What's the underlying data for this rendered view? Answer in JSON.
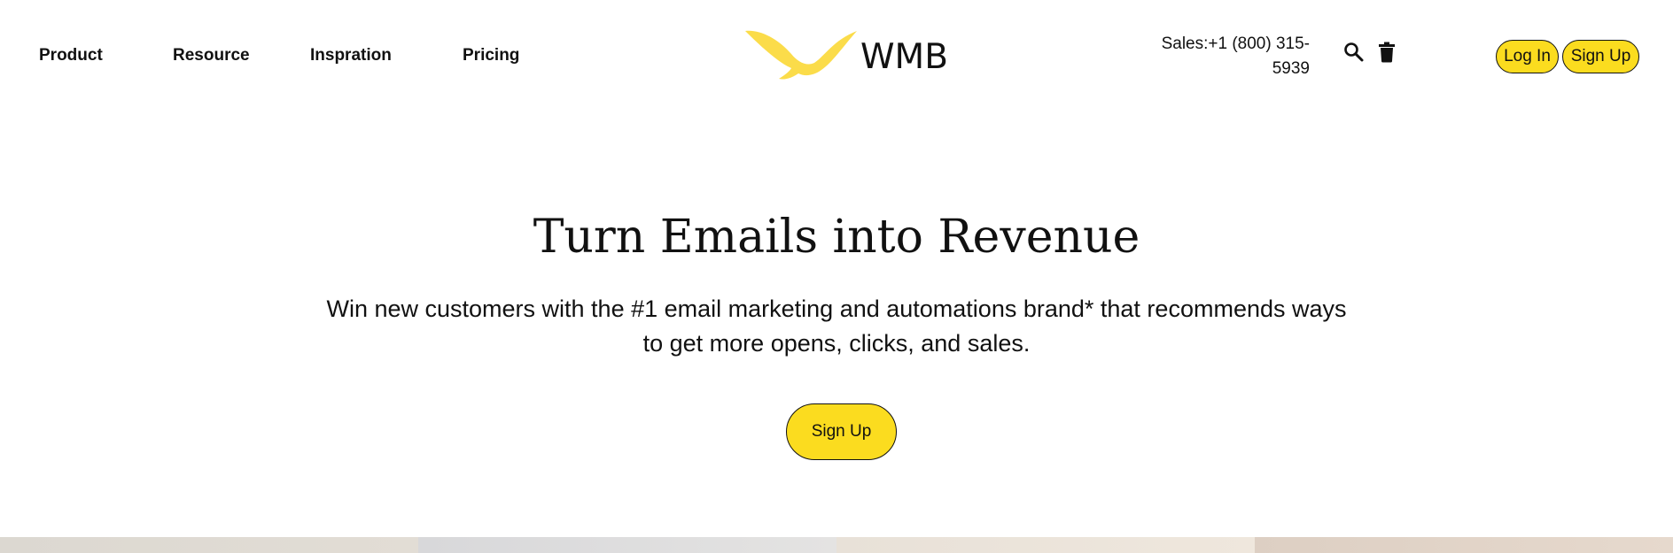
{
  "header": {
    "nav": [
      {
        "label": "Product"
      },
      {
        "label": "Resource"
      },
      {
        "label": "Inspration"
      },
      {
        "label": "Pricing"
      }
    ],
    "logo": {
      "text": "WMB",
      "icon": "bird-logo-icon",
      "color": "#fbdc4a"
    },
    "sales": "Sales:+1 (800) 315-5939",
    "icons": [
      "search-icon",
      "trash-icon"
    ],
    "login_label": "Log In",
    "signup_label": "Sign Up"
  },
  "hero": {
    "title": "Turn Emails into Revenue",
    "subtitle": "Win new customers with the #1 email marketing and automations brand* that recommends ways to get more opens, clicks, and sales.",
    "cta_label": "Sign Up"
  },
  "colors": {
    "accent": "#fbdc1f",
    "text": "#111111",
    "background": "#ffffff"
  }
}
